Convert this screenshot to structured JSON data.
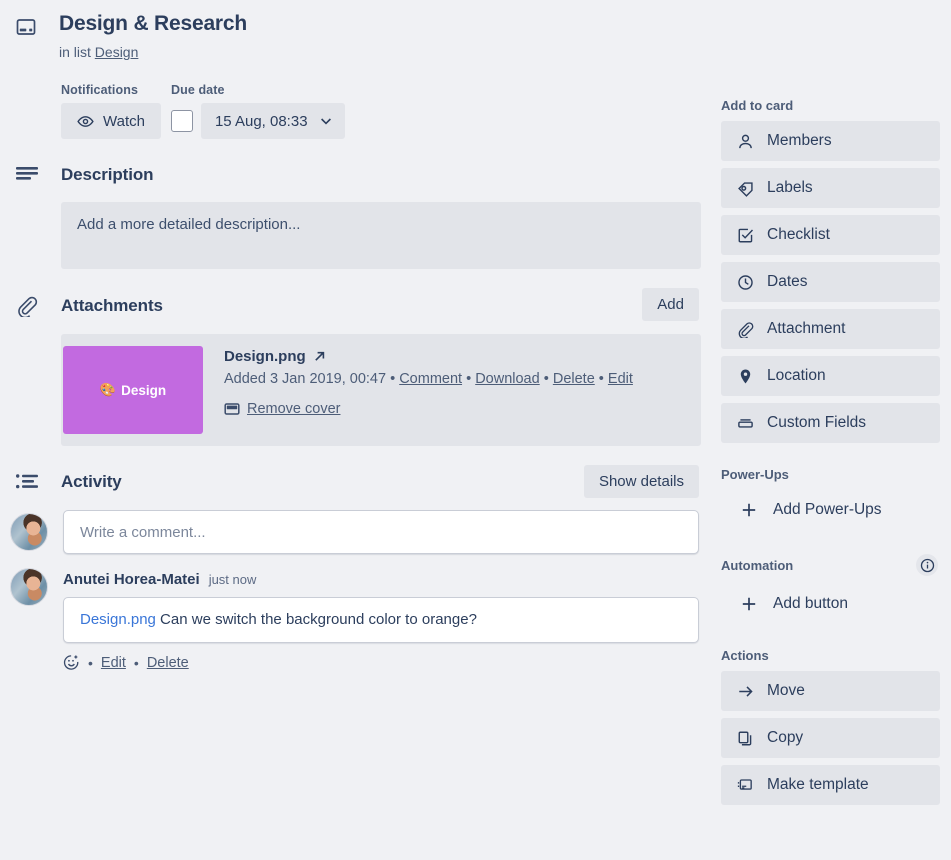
{
  "header": {
    "icon": "card-icon",
    "title": "Design & Research",
    "in_list_prefix": "in list",
    "list_name": "Design"
  },
  "meta": {
    "notifications_label": "Notifications",
    "watch_label": "Watch",
    "watch_icon": "eye-icon",
    "due_date_label": "Due date",
    "due_date_value": "15 Aug, 08:33",
    "due_chevron_icon": "chevron-down-icon",
    "due_checkbox_checked": false
  },
  "description": {
    "icon": "description-lines-icon",
    "title": "Description",
    "placeholder": "Add a more detailed description..."
  },
  "attachments": {
    "icon": "paperclip-icon",
    "title": "Attachments",
    "add_label": "Add",
    "items": [
      {
        "thumb_emoji": "🎨",
        "thumb_label": "Design",
        "thumb_color": "#c26ae0",
        "name": "Design.png",
        "external_icon": "external-link-icon",
        "added_text": "Added 3 Jan 2019, 00:47",
        "links": [
          "Comment",
          "Download",
          "Delete",
          "Edit"
        ],
        "remove_cover_label": "Remove cover",
        "remove_cover_icon": "cover-icon"
      }
    ]
  },
  "activity": {
    "icon": "activity-list-icon",
    "title": "Activity",
    "show_details_label": "Show details",
    "comment_placeholder": "Write a comment...",
    "avatar_name": "avatar",
    "entries": [
      {
        "author": "Anutei Horea-Matei",
        "time": "just now",
        "link_text": "Design.png",
        "text": " Can we switch the background color to orange?",
        "reaction_icon": "add-reaction-icon",
        "actions": [
          "Edit",
          "Delete"
        ]
      }
    ]
  },
  "sidebar": {
    "add_to_card": {
      "heading": "Add to card",
      "items": [
        {
          "label": "Members",
          "icon": "person-icon"
        },
        {
          "label": "Labels",
          "icon": "label-tag-icon"
        },
        {
          "label": "Checklist",
          "icon": "checkbox-icon"
        },
        {
          "label": "Dates",
          "icon": "clock-icon"
        },
        {
          "label": "Attachment",
          "icon": "paperclip-icon"
        },
        {
          "label": "Location",
          "icon": "location-pin-icon"
        },
        {
          "label": "Custom Fields",
          "icon": "custom-fields-icon"
        }
      ]
    },
    "power_ups": {
      "heading": "Power-Ups",
      "add_label": "Add Power-Ups",
      "add_icon": "plus-icon"
    },
    "automation": {
      "heading": "Automation",
      "info_icon": "info-icon",
      "add_label": "Add button",
      "add_icon": "plus-icon"
    },
    "actions": {
      "heading": "Actions",
      "items": [
        {
          "label": "Move",
          "icon": "arrow-right-icon"
        },
        {
          "label": "Copy",
          "icon": "copy-icon"
        },
        {
          "label": "Make template",
          "icon": "template-icon"
        }
      ]
    }
  },
  "colors": {
    "page_background": "#f0f1f4",
    "panel": "#e2e4e9",
    "text": "#2c3e5d",
    "muted_text": "#4d5d78",
    "link": "#3a76d8",
    "thumb": "#c26ae0"
  }
}
